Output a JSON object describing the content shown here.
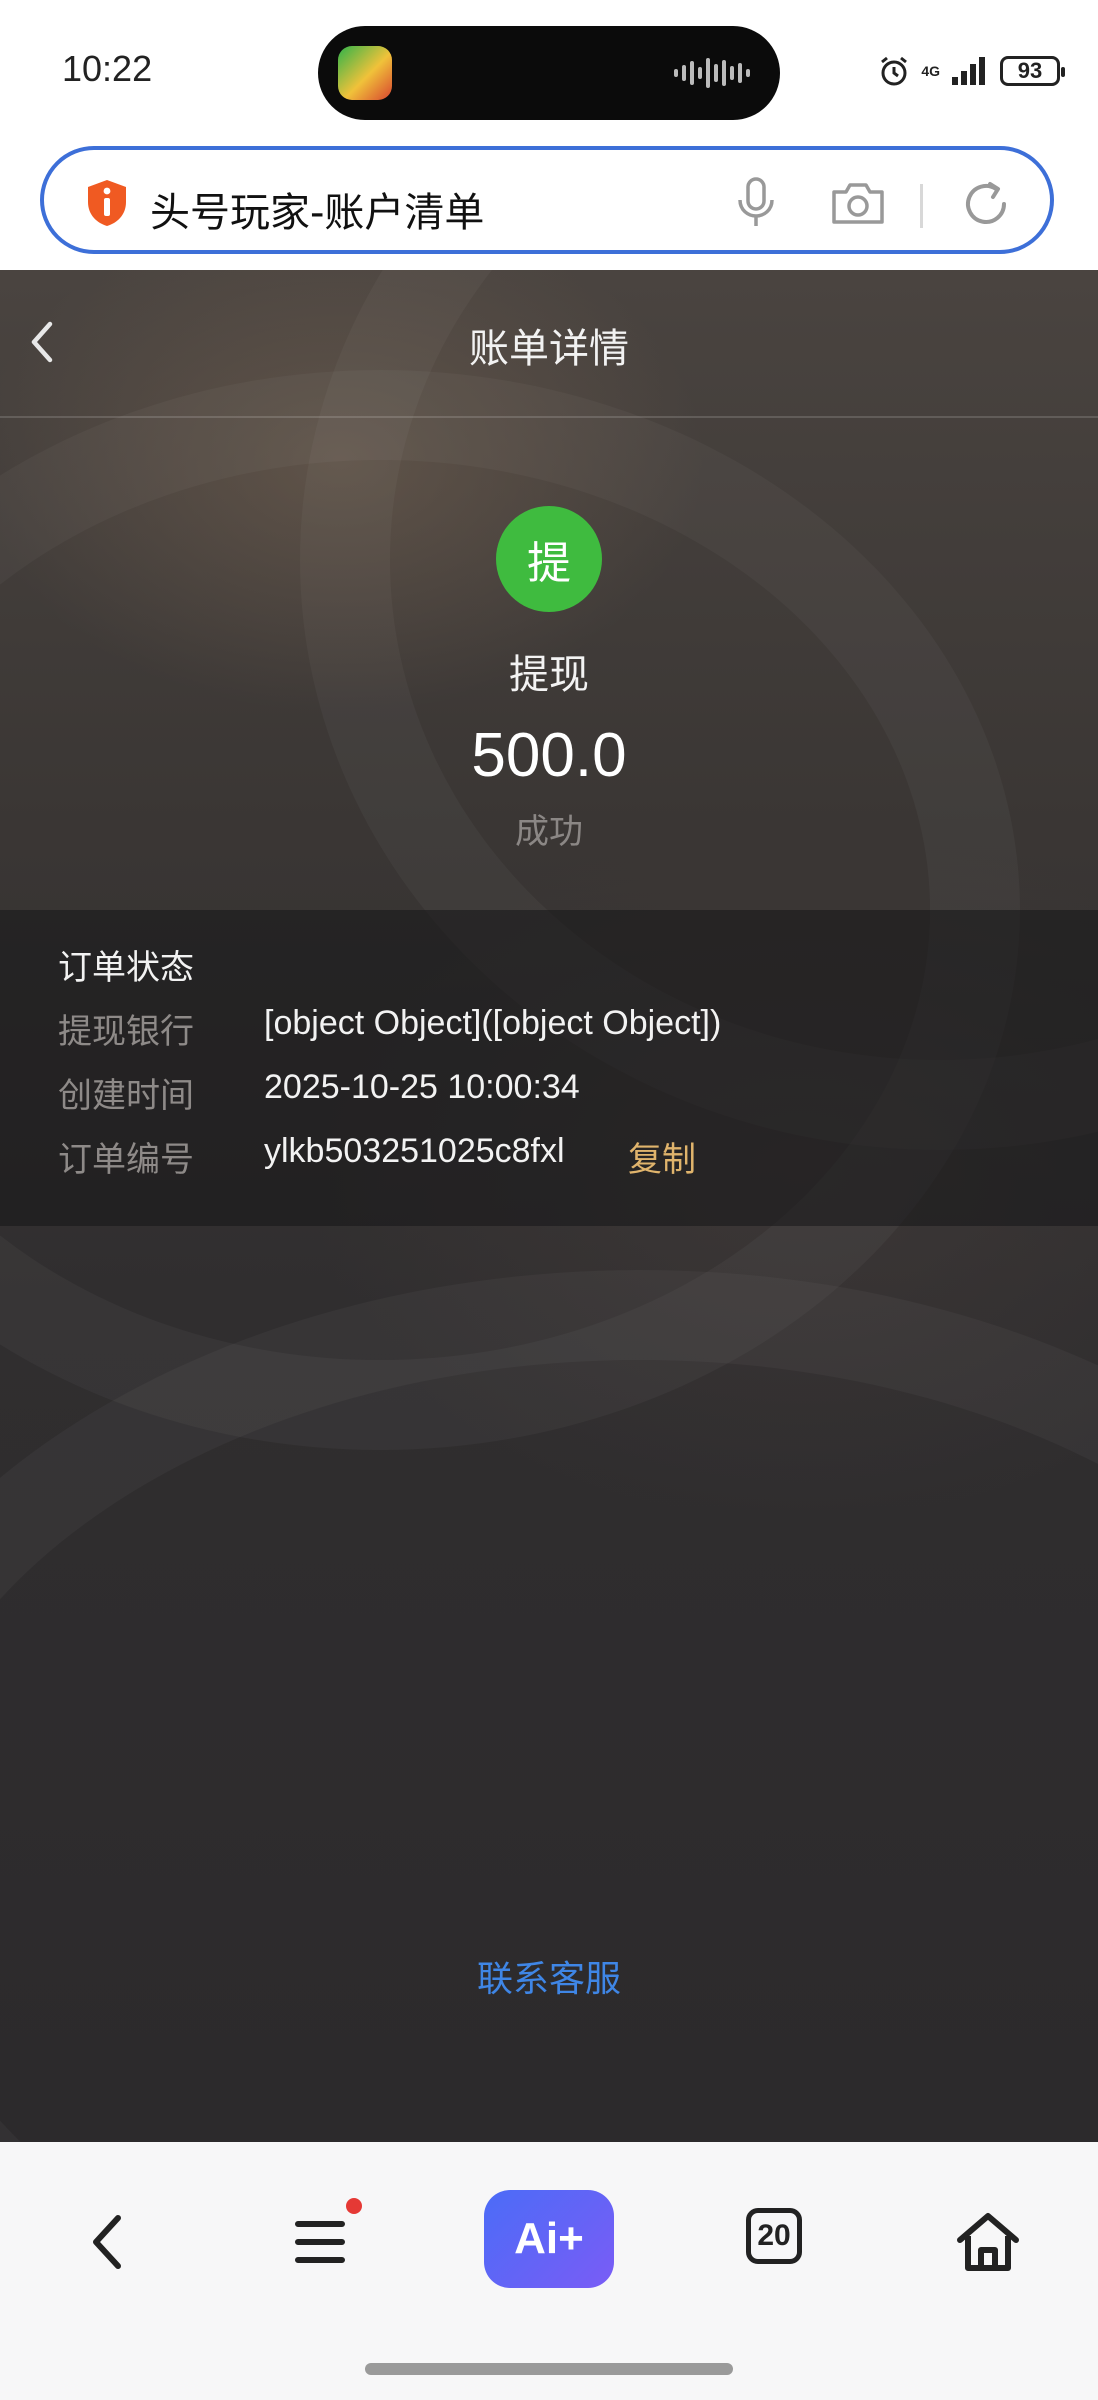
{
  "status_bar": {
    "time": "10:22",
    "network": "4G",
    "battery": "93"
  },
  "browser": {
    "search_text": "头号玩家-账户清单"
  },
  "header": {
    "title": "账单详情"
  },
  "summary": {
    "badge_char": "提",
    "type": "提现",
    "amount": "500.0",
    "status": "成功",
    "badge_color": "#3fbb3f"
  },
  "details": {
    "section_title": "订单状态",
    "rows": [
      {
        "label": "提现银行",
        "value": "[object Object]([object Object])"
      },
      {
        "label": "创建时间",
        "value": "2025-10-25 10:00:34"
      },
      {
        "label": "订单编号",
        "value": "ylkb503251025c8fxl"
      }
    ],
    "copy_label": "复制"
  },
  "footer": {
    "support_label": "联系客服"
  },
  "bottom_bar": {
    "ai_label": "Ai+",
    "tab_count": "20"
  },
  "colors": {
    "accent_blue": "#3d6fd8",
    "link_blue": "#3f86e6",
    "copy_gold": "#e0b46c"
  }
}
